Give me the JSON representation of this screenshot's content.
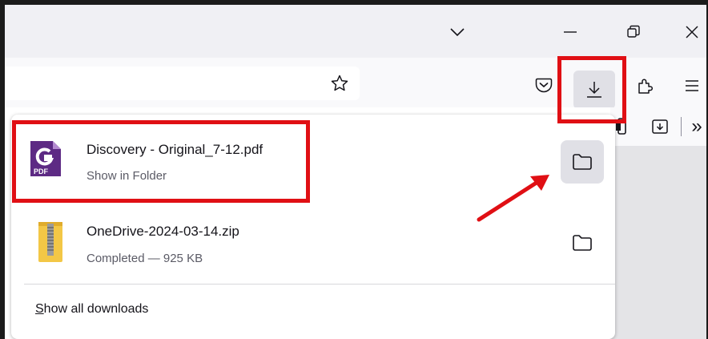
{
  "titlebar": {
    "buttons": [
      {
        "name": "tab-list-dropdown",
        "glyph": "chevron-down-icon"
      },
      {
        "name": "minimize",
        "glyph": "minimize-icon"
      },
      {
        "name": "restore",
        "glyph": "restore-icon"
      },
      {
        "name": "close",
        "glyph": "close-icon"
      }
    ]
  },
  "toolbar": {
    "icons": [
      "star-icon",
      "pocket-icon",
      "download-icon",
      "extensions-icon",
      "menu-icon",
      "bookmarks-overflow-icon"
    ],
    "overflow_label": "»"
  },
  "downloads_panel": {
    "items": [
      {
        "file_name": "Discovery - Original_7-12.pdf",
        "status": "Show in Folder",
        "file_type": "pdf",
        "icon_label": "PDF"
      },
      {
        "file_name": "OneDrive-2024-03-14.zip",
        "status": "Completed — 925 KB",
        "file_type": "zip"
      }
    ],
    "show_all": {
      "accesskey": "S",
      "rest": "how all downloads"
    }
  },
  "colors": {
    "highlight": "#e00f14",
    "pdf_purple": "#5d2a84",
    "zip_yellow": "#f3c746",
    "hover_bg": "#e0e0e6"
  }
}
